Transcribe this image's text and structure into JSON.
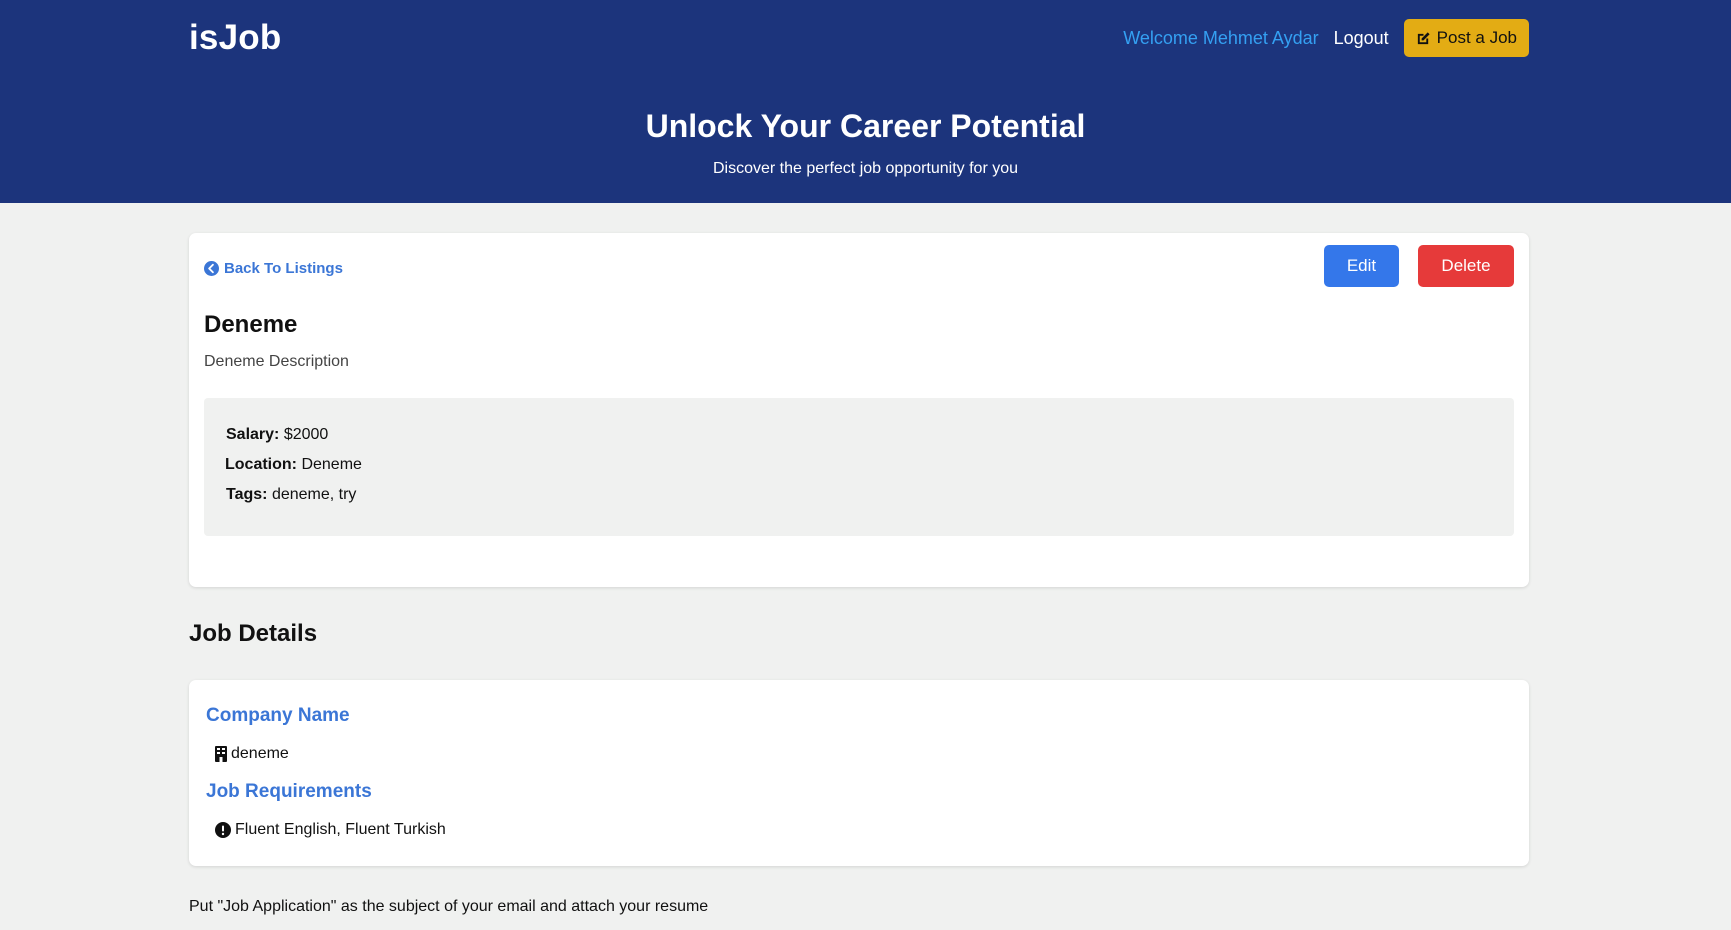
{
  "nav": {
    "logo": "isJob",
    "welcome": "Welcome Mehmet Aydar",
    "logout": "Logout",
    "post_job": "Post a Job"
  },
  "hero": {
    "title": "Unlock Your Career Potential",
    "subtitle": "Discover the perfect job opportunity for you"
  },
  "listing": {
    "back_label": "Back To Listings",
    "edit_label": "Edit",
    "delete_label": "Delete",
    "title": "Deneme",
    "description": "Deneme Description",
    "salary_label": "Salary:",
    "salary_value": "$2000",
    "location_label": "Location:",
    "location_value": "Deneme",
    "tags_label": "Tags:",
    "tags_value": "deneme, try"
  },
  "details": {
    "section_title": "Job Details",
    "company_heading": "Company Name",
    "company_value": "deneme",
    "requirements_heading": "Job Requirements",
    "requirements_value": "Fluent English, Fluent Turkish"
  },
  "footnote": "Put \"Job Application\" as the subject of your email and attach your resume",
  "icons": {
    "post_job": "edit-icon",
    "back": "arrow-circle-left-icon",
    "company": "building-icon",
    "requirements": "exclamation-circle-icon"
  },
  "colors": {
    "header_bg": "#1c347c",
    "accent_blue": "#3b76d6",
    "welcome_blue": "#34a0f2",
    "post_button": "#e3ac14",
    "edit_button": "#3477ea",
    "delete_button": "#e63a3a",
    "page_bg": "#f0f1f0"
  }
}
